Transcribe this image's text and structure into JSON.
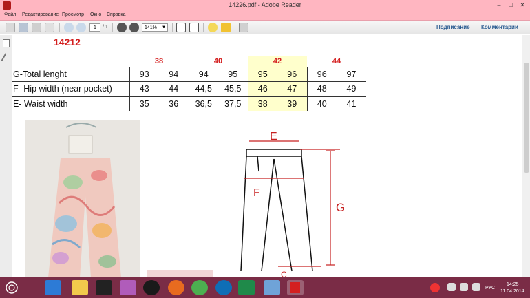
{
  "window": {
    "title": "14226.pdf - Adobe Reader"
  },
  "menu": [
    "Файл",
    "Редактирование",
    "Просмотр",
    "Окно",
    "Справка"
  ],
  "toolbar": {
    "page_current": "1",
    "page_total": "/ 1",
    "zoom": "141%",
    "sign_label": "Подписание",
    "comments_label": "Комментарии"
  },
  "document": {
    "model_number": "14212",
    "size_headers": [
      "38",
      "40",
      "42",
      "44"
    ],
    "rows": [
      {
        "label": "G-Total lenght",
        "values": [
          "93",
          "94",
          "94",
          "95",
          "95",
          "96",
          "96",
          "97"
        ]
      },
      {
        "label": "F- Hip width (near pocket)",
        "values": [
          "43",
          "44",
          "44,5",
          "45,5",
          "46",
          "47",
          "48",
          "49"
        ]
      },
      {
        "label": "E- Waist width",
        "values": [
          "35",
          "36",
          "36,5",
          "37,5",
          "38",
          "39",
          "40",
          "41"
        ]
      }
    ],
    "diagram_labels": {
      "e": "E",
      "f": "F",
      "g": "G",
      "c": "C"
    }
  },
  "taskbar": {
    "lang": "РУС",
    "time": "14:25",
    "date": "11.04.2014"
  },
  "colors": {
    "titlebar": "#ffb6c1",
    "accent_red": "#d42020",
    "highlight": "#ffffcc",
    "taskbar": "#7a2c46"
  }
}
